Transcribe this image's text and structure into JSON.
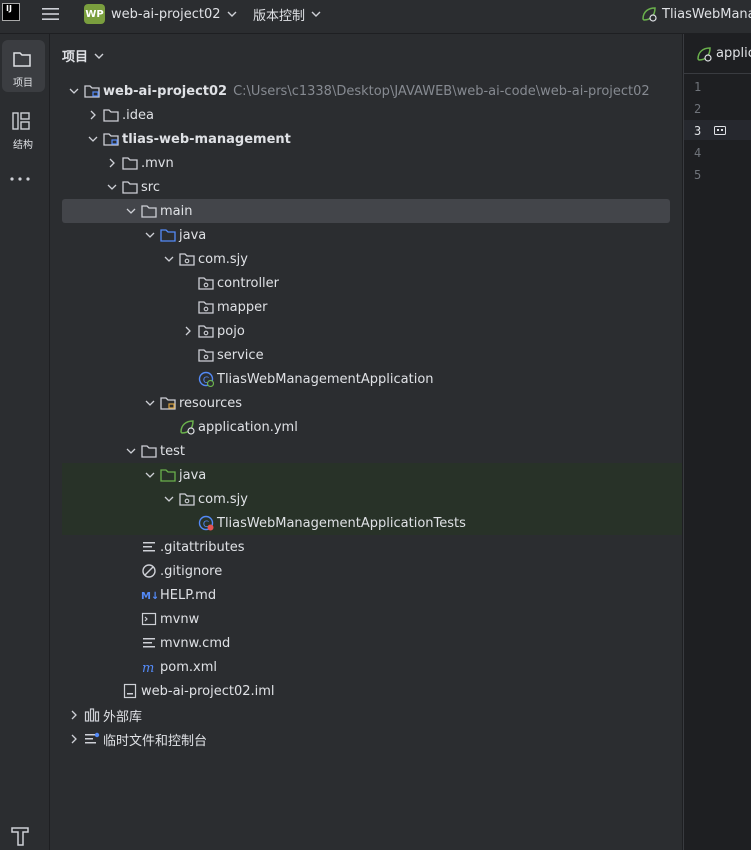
{
  "titlebar": {
    "logo": "IJ",
    "project_badge": "WP",
    "project_name": "web-ai-project02",
    "vcs_label": "版本控制",
    "run_config": "TliasWebManag"
  },
  "toolstrip": {
    "project_label": "项目",
    "structure_label": "结构"
  },
  "panel": {
    "title": "项目"
  },
  "tree": [
    {
      "label": "web-ai-project02",
      "path": "C:\\Users\\c1338\\Desktop\\JAVAWEB\\web-ai-code\\web-ai-project02",
      "icon": "module-folder-icon",
      "arrow": "down",
      "bold": true
    },
    {
      "label": ".idea",
      "icon": "folder-icon",
      "arrow": "right"
    },
    {
      "label": "tlias-web-management",
      "icon": "module-folder-icon",
      "arrow": "down",
      "bold": true
    },
    {
      "label": ".mvn",
      "icon": "folder-icon",
      "arrow": "right"
    },
    {
      "label": "src",
      "icon": "folder-icon",
      "arrow": "down"
    },
    {
      "label": "main",
      "icon": "folder-icon",
      "arrow": "down",
      "selected": true
    },
    {
      "label": "java",
      "icon": "source-folder-icon",
      "arrow": "down"
    },
    {
      "label": "com.sjy",
      "icon": "package-icon",
      "arrow": "down"
    },
    {
      "label": "controller",
      "icon": "package-icon",
      "arrow": "none"
    },
    {
      "label": "mapper",
      "icon": "package-icon",
      "arrow": "none"
    },
    {
      "label": "pojo",
      "icon": "package-icon",
      "arrow": "right"
    },
    {
      "label": "service",
      "icon": "package-icon",
      "arrow": "none"
    },
    {
      "label": "TliasWebManagementApplication",
      "icon": "spring-boot-class-icon",
      "arrow": "none"
    },
    {
      "label": "resources",
      "icon": "resources-folder-icon",
      "arrow": "down"
    },
    {
      "label": "application.yml",
      "icon": "spring-yml-icon",
      "arrow": "none"
    },
    {
      "label": "test",
      "icon": "folder-icon",
      "arrow": "down"
    },
    {
      "label": "java",
      "icon": "test-source-folder-icon",
      "arrow": "down",
      "test": true
    },
    {
      "label": "com.sjy",
      "icon": "package-icon",
      "arrow": "down",
      "test": true
    },
    {
      "label": "TliasWebManagementApplicationTests",
      "icon": "test-class-icon",
      "arrow": "none",
      "test": true
    },
    {
      "label": ".gitattributes",
      "icon": "text-file-icon",
      "arrow": "none"
    },
    {
      "label": ".gitignore",
      "icon": "ignore-file-icon",
      "arrow": "none"
    },
    {
      "label": "HELP.md",
      "icon": "markdown-icon",
      "arrow": "none"
    },
    {
      "label": "mvnw",
      "icon": "shell-script-icon",
      "arrow": "none"
    },
    {
      "label": "mvnw.cmd",
      "icon": "text-file-icon",
      "arrow": "none"
    },
    {
      "label": "pom.xml",
      "icon": "maven-icon",
      "arrow": "none"
    },
    {
      "label": "web-ai-project02.iml",
      "icon": "iml-file-icon",
      "arrow": "none"
    },
    {
      "label": "外部库",
      "icon": "libraries-icon",
      "arrow": "right"
    },
    {
      "label": "临时文件和控制台",
      "icon": "scratches-icon",
      "arrow": "right"
    }
  ],
  "editor": {
    "tab_label": "applic",
    "line_numbers": [
      "1",
      "2",
      "3",
      "4",
      "5"
    ],
    "current_line": "3"
  },
  "colors": {
    "accent": "#548af7",
    "selection": "#43454a",
    "test_bg": "#283228",
    "spring": "#6ab04c"
  }
}
